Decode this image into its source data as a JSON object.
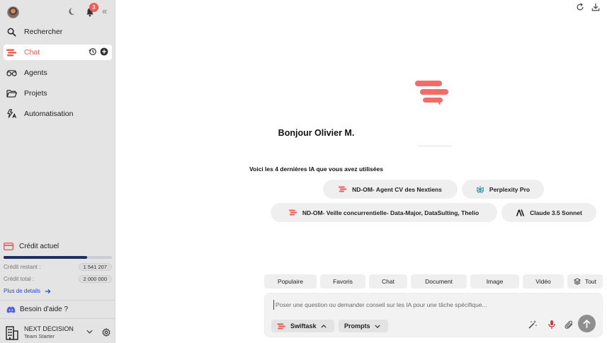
{
  "header": {
    "notification_count": "3"
  },
  "sidebar": {
    "items": [
      {
        "label": "Rechercher"
      },
      {
        "label": "Chat"
      },
      {
        "label": "Agents"
      },
      {
        "label": "Projets"
      },
      {
        "label": "Automatisation"
      }
    ],
    "credit": {
      "title": "Crédit actuel",
      "remaining_label": "Crédit restant :",
      "remaining_value": "1 541 207",
      "total_label": "Crédit total :",
      "total_value": "2 000 000",
      "details_link": "Plus de details",
      "fill_fraction": 0.77
    },
    "help_label": "Besoin d'aide ?",
    "team": {
      "name": "NEXT DECISION",
      "plan": "Team Starter"
    }
  },
  "main": {
    "greeting": "Bonjour Olivier M.",
    "recent_title": "Voici les 4 dernières IA que vous avez utilisées",
    "recent_ai": [
      {
        "label": "ND-OM- Agent CV des Nextiens",
        "icon": "swiftask-logo-icon"
      },
      {
        "label": "Perplexity Pro",
        "icon": "perplexity-icon"
      },
      {
        "label": "ND-OM- Veille concurrentielle- Data-Major, DataSulting, Thelio",
        "icon": "swiftask-logo-icon"
      },
      {
        "label": "Claude 3.5 Sonnet",
        "icon": "anthropic-icon"
      }
    ],
    "categories": [
      "Populaire",
      "Favoris",
      "Chat",
      "Document",
      "Image",
      "Vidéo",
      "Tout"
    ],
    "composer": {
      "placeholder": "Poser une question ou demander conseil sur les IA pour une tâche spécifique...",
      "model_button": "Swiftask",
      "prompts_button": "Prompts"
    }
  },
  "colors": {
    "accent": "#f05a55",
    "credit_bar": "#1e2f63",
    "link": "#1f4ad6"
  }
}
